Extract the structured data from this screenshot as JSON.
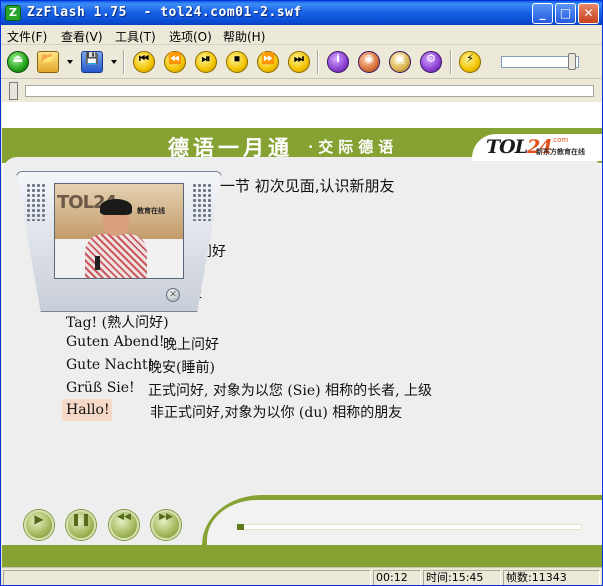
{
  "window": {
    "title": "ZzFlash 1.75  - tol24.com01-2.swf",
    "app_icon_letter": "Z",
    "minimize_glyph": "_",
    "maximize_glyph": "□",
    "close_glyph": "✕"
  },
  "menu": {
    "items": [
      {
        "label": "文件(F)"
      },
      {
        "label": "查看(V)"
      },
      {
        "label": "工具(T)"
      },
      {
        "label": "选项(O)"
      },
      {
        "label": "帮助(H)"
      }
    ]
  },
  "toolbar": {
    "buttons": [
      {
        "name": "eject-icon",
        "glyph": "⏏"
      },
      {
        "name": "open-folder-icon",
        "glyph": "📂"
      },
      {
        "name": "save-icon",
        "glyph": "💾"
      },
      {
        "name": "skip-to-start-icon",
        "glyph": "⏮"
      },
      {
        "name": "rewind-icon",
        "glyph": "⏪"
      },
      {
        "name": "play-pause-icon",
        "glyph": "⏯"
      },
      {
        "name": "stop-icon",
        "glyph": "⏹"
      },
      {
        "name": "fast-forward-icon",
        "glyph": "⏩"
      },
      {
        "name": "skip-to-end-icon",
        "glyph": "⏭"
      },
      {
        "name": "info-icon",
        "glyph": "i"
      },
      {
        "name": "capture-icon",
        "glyph": "◉"
      },
      {
        "name": "image-edit-icon",
        "glyph": "▣"
      },
      {
        "name": "settings-icon",
        "glyph": "⚙"
      },
      {
        "name": "run-icon",
        "glyph": "⚡"
      }
    ],
    "volume_level": 0.95
  },
  "seek": {
    "position": 0.0
  },
  "content": {
    "banner_title": "德语一月通",
    "banner_subtitle": "·交际德语",
    "logo_main": "TOL",
    "logo_num": "24",
    "logo_com": ".com",
    "logo_sub": "新东方教育在线",
    "lesson_heading": "一节  初次见面,认识新朋友",
    "fragment_1": "问好",
    "fragment_2": "好",
    "phrases": [
      {
        "de": "Tag! (熟人问好)",
        "zh": ""
      },
      {
        "de": "Guten Abend!",
        "zh": "晚上问好"
      },
      {
        "de": "Gute Nacht!",
        "zh": "晚安(睡前)"
      },
      {
        "de": "Grüß Sie!",
        "zh": "正式问好, 对象为以您 (Sie) 相称的长者, 上级"
      },
      {
        "de": "Hallo!",
        "zh": "非正式问好,对象为以你 (du) 相称的朋友"
      }
    ],
    "video_logo": "TOL24",
    "video_logo_sub": "教育在线",
    "video_close_glyph": "✕"
  },
  "player": {
    "buttons": [
      {
        "name": "play-icon",
        "glyph": "▶"
      },
      {
        "name": "pause-icon",
        "glyph": "❚❚"
      },
      {
        "name": "rewind-icon",
        "glyph": "◀◀"
      },
      {
        "name": "forward-icon",
        "glyph": "▶▶"
      }
    ],
    "progress": 0.02
  },
  "status": {
    "time_elapsed": "00:12",
    "time_total": "时间:15:45",
    "frame_count": "帧数:11343"
  }
}
